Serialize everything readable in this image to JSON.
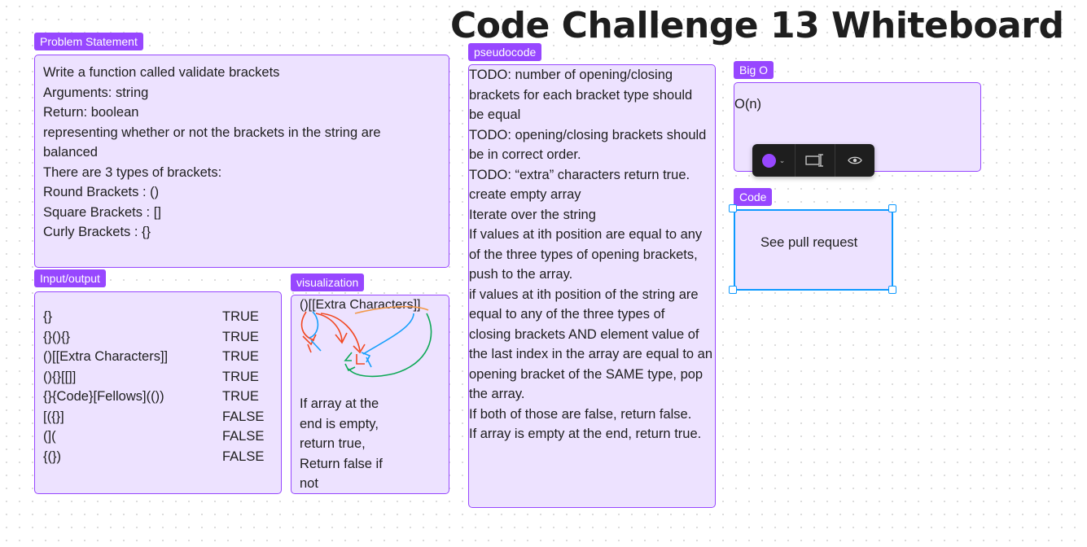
{
  "title": "Code Challenge 13 Whiteboard",
  "problem": {
    "tag": "Problem Statement",
    "lines": [
      "Write a function called validate brackets",
      "Arguments: string",
      "Return: boolean",
      "representing whether or not the brackets in the string are",
      "balanced",
      "There are 3 types of brackets:",
      "",
      "Round Brackets : ()",
      "Square Brackets : []",
      "Curly Brackets : {}"
    ]
  },
  "io": {
    "tag": "Input/output",
    "rows": [
      {
        "input": "{}",
        "output": "TRUE"
      },
      {
        "input": "{}(){}",
        "output": "TRUE"
      },
      {
        "input": "()[[Extra Characters]]",
        "output": "TRUE"
      },
      {
        "input": "(){}[[]]",
        "output": "TRUE"
      },
      {
        "input": "{}{Code}[Fellows](())",
        "output": "TRUE"
      },
      {
        "input": "[({}]",
        "output": "FALSE"
      },
      {
        "input": "(](",
        "output": "FALSE"
      },
      {
        "input": "{(})",
        "output": "FALSE"
      }
    ]
  },
  "visualization": {
    "tag": "visualization",
    "sample": "()[[Extra Characters]]",
    "note_lines": [
      "If array at the",
      "end is empty,",
      "return true,",
      "Return false if",
      "not"
    ]
  },
  "pseudocode": {
    "tag": "pseudocode",
    "lines": [
      "TODO: number of opening/closing",
      "brackets for each bracket type should",
      "be equal",
      "TODO: opening/closing brackets should",
      "be in correct order.",
      "TODO: “extra” characters return true.",
      "",
      "create empty array",
      "Iterate over the string",
      "If values at ith position are equal to any",
      "of the three types of opening brackets,",
      "push to the array.",
      "if values at ith position of the string are",
      "equal to any of the three types of",
      "closing brackets AND element value of",
      "the last index in the array are equal to an",
      "opening bracket of the SAME type, pop",
      "the array.",
      "If both of those are false, return false.",
      "If array is empty at the end, return true."
    ]
  },
  "bigo": {
    "tag": "Big O",
    "text": "O(n)"
  },
  "code": {
    "tag": "Code",
    "text": "See pull request"
  },
  "toolbar": {
    "color_icon": "color-swatch-icon",
    "resize_icon": "resize-text-icon",
    "view_icon": "eye-icon",
    "swatch_color": "#9747ff"
  },
  "colors": {
    "accent": "#9747ff",
    "fill": "#ede2ff",
    "selection": "#0d99ff"
  }
}
